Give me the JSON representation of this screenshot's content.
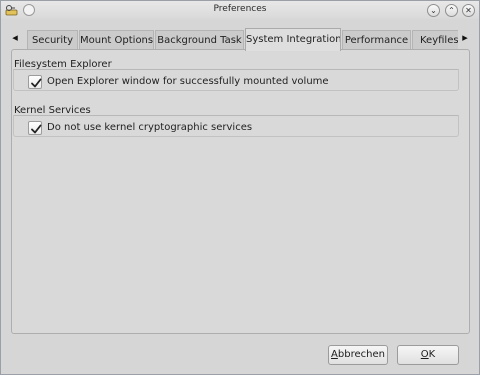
{
  "window": {
    "title": "Preferences"
  },
  "titlebar": {
    "app_icon": "key-drive-icon",
    "left_button_icon": "circle-icon",
    "minimize_icon": "chevron-down-icon",
    "maximize_icon": "chevron-up-icon",
    "close_icon": "close-icon",
    "minimize_glyph": "⌄",
    "maximize_glyph": "⌃",
    "close_glyph": "✕"
  },
  "tabs": {
    "scroll_left_glyph": "◂",
    "scroll_right_glyph": "▸",
    "items": [
      {
        "label": "Security"
      },
      {
        "label": "Mount Options"
      },
      {
        "label": "Background Task"
      },
      {
        "label": "System Integration"
      },
      {
        "label": "Performance"
      },
      {
        "label": "Keyfiles"
      }
    ],
    "active_index": 3
  },
  "groups": [
    {
      "title": "Filesystem Explorer",
      "checkbox": {
        "label": "Open Explorer window for successfully mounted volume",
        "checked": true
      }
    },
    {
      "title": "Kernel Services",
      "checkbox": {
        "label": "Do not use kernel cryptographic services",
        "checked": true
      }
    }
  ],
  "buttons": {
    "cancel": {
      "mnemonic": "A",
      "rest": "bbrechen"
    },
    "ok": {
      "mnemonic": "O",
      "rest": "K"
    }
  },
  "colors": {
    "window_bg": "#d6d6d6",
    "checkmark": "#222222"
  }
}
